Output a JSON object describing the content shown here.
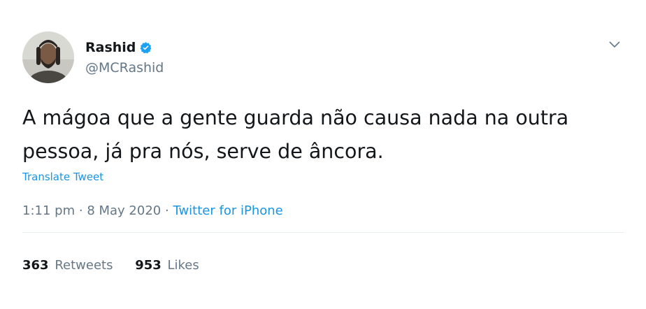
{
  "author": {
    "display_name": "Rashid",
    "handle": "@MCRashid",
    "verified": true,
    "avatar_icon": "user-avatar"
  },
  "tweet": {
    "text": "A mágoa que a gente guarda não causa nada na outra pessoa, já pra nós, serve de âncora.",
    "translate_label": "Translate Tweet"
  },
  "meta": {
    "time": "1:11 pm",
    "separator": "·",
    "date": "8 May 2020",
    "source": "Twitter for iPhone"
  },
  "stats": {
    "retweets_count": "363",
    "retweets_label": "Retweets",
    "likes_count": "953",
    "likes_label": "Likes"
  },
  "colors": {
    "accent": "#1b95e0",
    "verified": "#1da1f2",
    "muted": "#657786",
    "text": "#14171a"
  }
}
